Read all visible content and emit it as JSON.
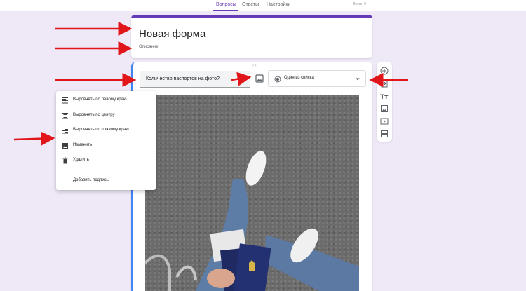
{
  "header": {
    "tabs": [
      {
        "label": "Вопросы"
      },
      {
        "label": "Ответы"
      },
      {
        "label": "Настройки"
      }
    ],
    "total": "Всего: 0"
  },
  "form": {
    "title": "Новая форма",
    "description": "Описание"
  },
  "question": {
    "text": "Количество паспортов на фото?",
    "type": "Один из списка"
  },
  "image_menu": {
    "items": [
      {
        "label": "Выровнять по левому краю",
        "icon": "align-left-icon"
      },
      {
        "label": "Выровнять по центру",
        "icon": "align-center-icon"
      },
      {
        "label": "Выровнять по правому краю",
        "icon": "align-right-icon"
      },
      {
        "label": "Изменить",
        "icon": "image-icon"
      },
      {
        "label": "Удалить",
        "icon": "trash-icon"
      }
    ],
    "add_caption": "Добавить подпись"
  },
  "sidebar": {
    "icons": [
      "add-question-icon",
      "import-questions-icon",
      "add-title-icon",
      "add-image-icon",
      "add-video-icon",
      "add-section-icon"
    ]
  },
  "colors": {
    "accent": "#673ab7",
    "active_border": "#4285f4",
    "annotation_arrow": "#e0161b",
    "background": "#efe9f7"
  }
}
